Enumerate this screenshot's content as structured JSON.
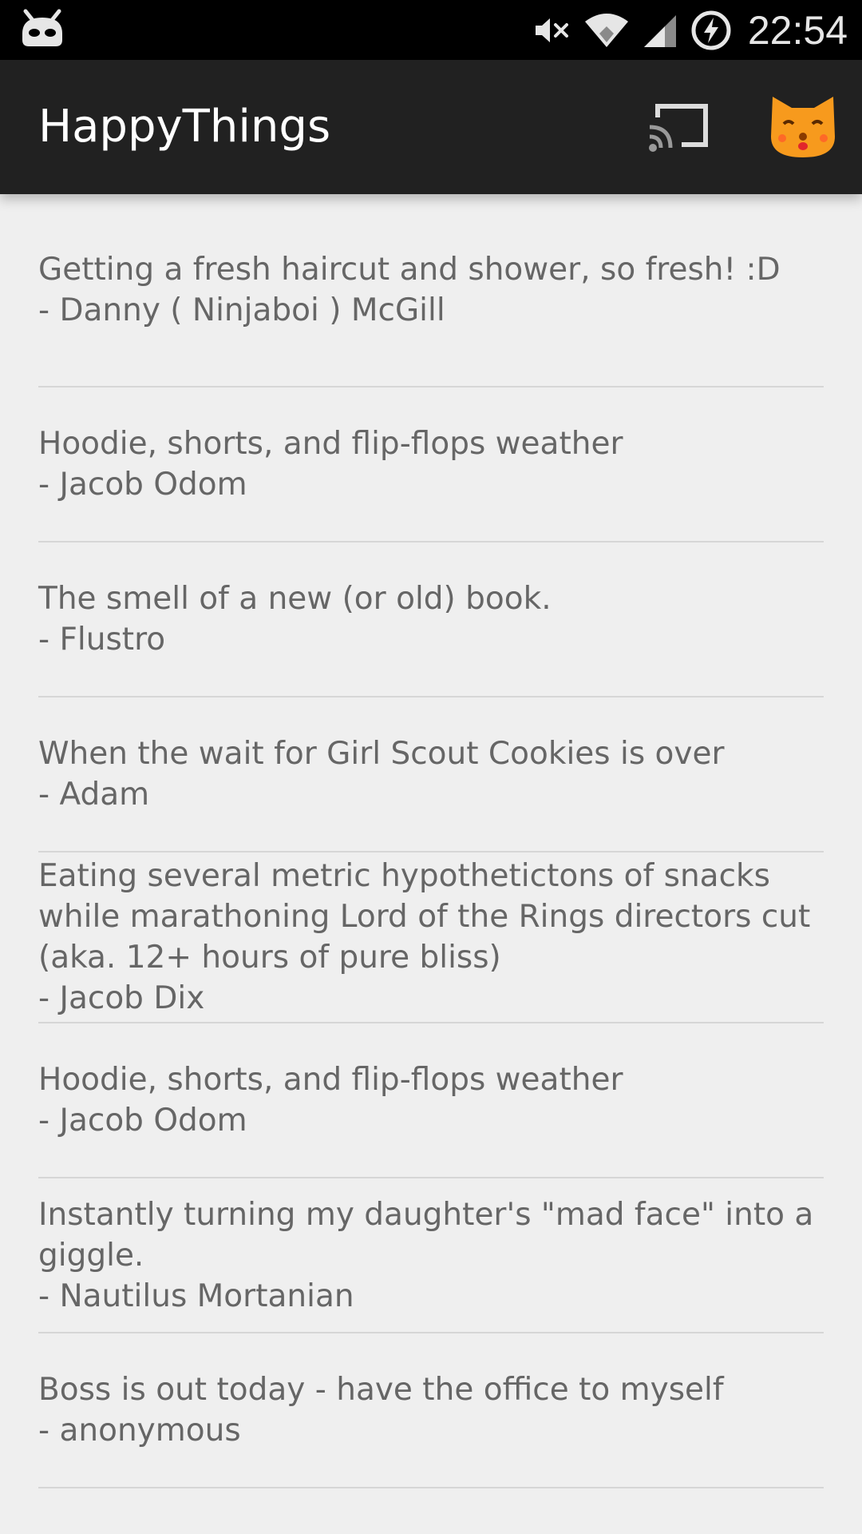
{
  "status_bar": {
    "time": "22:54",
    "icons": [
      "android-head-icon",
      "mute-icon",
      "wifi-icon",
      "cell-signal-icon",
      "battery-charging-icon"
    ]
  },
  "app_bar": {
    "title": "HappyThings",
    "icons": [
      "cast-icon",
      "cat-face-icon"
    ],
    "colors": {
      "background": "#212121",
      "cat": "#f79a1d"
    }
  },
  "items": [
    {
      "text": "Getting a fresh haircut and shower, so fresh! :D",
      "author": "- Danny ( Ninjaboi ) McGill"
    },
    {
      "text": "Hoodie, shorts, and flip-flops weather",
      "author": "- Jacob Odom"
    },
    {
      "text": "The smell of a new (or old) book.",
      "author": "- Flustro"
    },
    {
      "text": "When the wait for Girl Scout Cookies is over",
      "author": "- Adam"
    },
    {
      "text": "Eating several metric hypothetictons of snacks while marathoning Lord of the Rings directors cut (aka. 12+ hours of pure bliss)",
      "author": "- Jacob Dix"
    },
    {
      "text": "Hoodie, shorts, and flip-flops weather",
      "author": "- Jacob Odom"
    },
    {
      "text": "Instantly turning my daughter's \"mad face\" into a giggle.",
      "author": "- Nautilus Mortanian"
    },
    {
      "text": "Boss is out today - have the office to myself",
      "author": "- anonymous"
    }
  ]
}
